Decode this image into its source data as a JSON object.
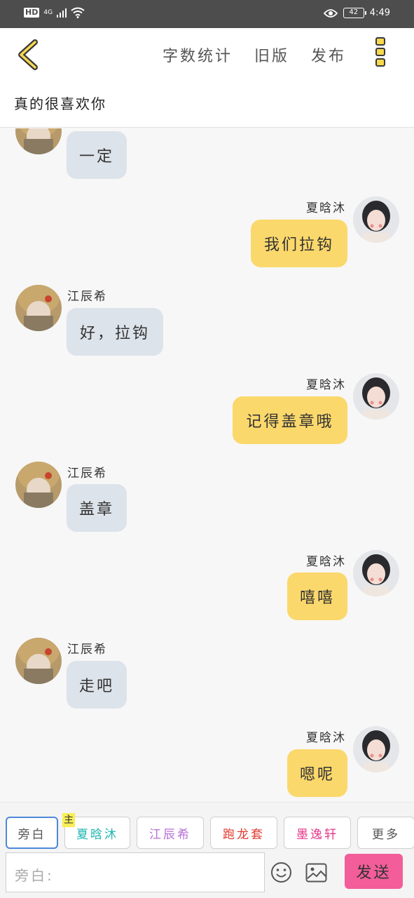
{
  "status_bar": {
    "hd": "HD",
    "network": "4G",
    "battery": "42",
    "time": "4:49"
  },
  "header": {
    "back_icon": "chevron-left-icon",
    "actions": [
      "字数统计",
      "旧版",
      "发布"
    ],
    "more_icon": "more-vertical-icon",
    "title": "真的很喜欢你"
  },
  "chat": {
    "messages": [
      {
        "side": "left",
        "name": "",
        "text": "一定"
      },
      {
        "side": "right",
        "name": "夏晗沐",
        "text": "我们拉钩"
      },
      {
        "side": "left",
        "name": "江辰希",
        "text": "好，拉钩"
      },
      {
        "side": "right",
        "name": "夏晗沐",
        "text": "记得盖章哦"
      },
      {
        "side": "left",
        "name": "江辰希",
        "text": "盖章"
      },
      {
        "side": "right",
        "name": "夏晗沐",
        "text": "嘻嘻"
      },
      {
        "side": "left",
        "name": "江辰希",
        "text": "走吧"
      },
      {
        "side": "right",
        "name": "夏晗沐",
        "text": "嗯呢"
      }
    ]
  },
  "bottom": {
    "roles": [
      {
        "label": "旁白",
        "color": "#555555"
      },
      {
        "label": "夏晗沐",
        "color": "#1fb5b1",
        "tag": "主"
      },
      {
        "label": "江辰希",
        "color": "#b76fd6"
      },
      {
        "label": "跑龙套",
        "color": "#e0392d"
      },
      {
        "label": "墨逸轩",
        "color": "#e6378b"
      },
      {
        "label": "更多",
        "color": "#555555"
      }
    ],
    "input_placeholder": "旁白:",
    "emoji_icon": "smiley-icon",
    "image_icon": "image-icon",
    "send_label": "发送"
  },
  "colors": {
    "accent_yellow": "#fbd86c",
    "bubble_grey": "#dde3ea",
    "send_pink": "#f25d9a",
    "active_blue": "#4e88d9"
  }
}
